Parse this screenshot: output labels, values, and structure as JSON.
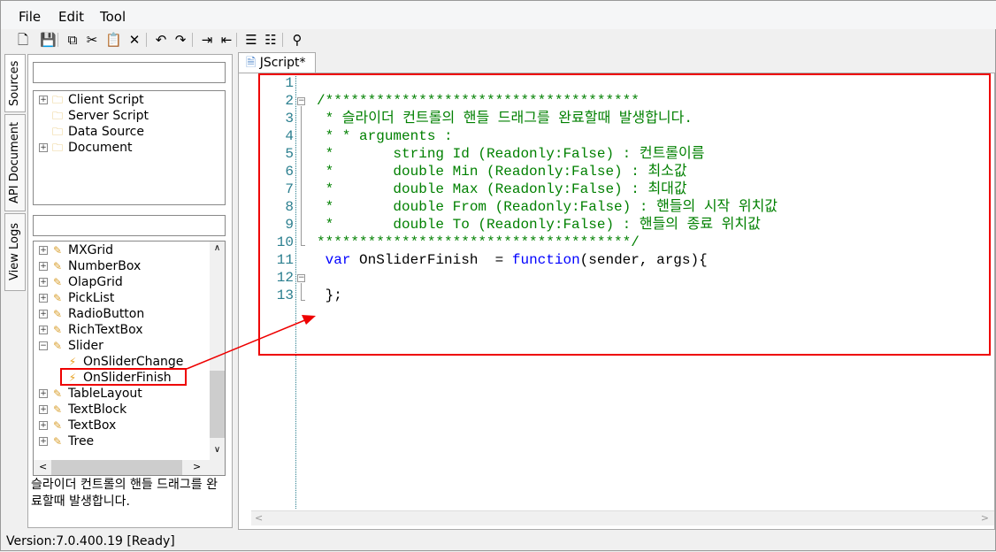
{
  "menu": [
    "File",
    "Edit",
    "Tool"
  ],
  "toolbar": [
    {
      "icon": "new-file-icon",
      "glyph": "🗋"
    },
    {
      "icon": "save-icon",
      "glyph": "💾"
    },
    {
      "icon": "copy-icon",
      "glyph": "⧉"
    },
    {
      "icon": "cut-icon",
      "glyph": "✂"
    },
    {
      "icon": "paste-icon",
      "glyph": "📋"
    },
    {
      "icon": "delete-icon",
      "glyph": "✕"
    },
    {
      "icon": "undo-icon",
      "glyph": "↶"
    },
    {
      "icon": "redo-icon",
      "glyph": "↷"
    },
    {
      "icon": "indent-icon",
      "glyph": "⇥"
    },
    {
      "icon": "outdent-icon",
      "glyph": "⇤"
    },
    {
      "icon": "comment-icon",
      "glyph": "☰"
    },
    {
      "icon": "uncomment-icon",
      "glyph": "☷"
    },
    {
      "icon": "find-icon",
      "glyph": "⚲"
    }
  ],
  "side_tabs": [
    "Sources",
    "API Document",
    "View Logs"
  ],
  "top_tree": [
    "Client Script",
    "Server Script",
    "Data Source",
    "Document"
  ],
  "control_tree": [
    "MXGrid",
    "NumberBox",
    "OlapGrid",
    "PickList",
    "RadioButton",
    "RichTextBox",
    "Slider",
    "OnSliderChange",
    "OnSliderFinish",
    "TableLayout",
    "TextBlock",
    "TextBox",
    "Tree"
  ],
  "description": "슬라이더 컨트롤의 핸들 드래그를 완료할때 발생합니다.",
  "editor_tab": "JScript*",
  "code_lines": [
    "",
    "/*************************************",
    " * 슬라이더 컨트롤의 핸들 드래그를 완료할때 발생합니다.",
    " * * arguments :",
    " *       string Id (Readonly:False) : 컨트롤이름",
    " *       double Min (Readonly:False) : 최소값",
    " *       double Max (Readonly:False) : 최대값",
    " *       double From (Readonly:False) : 핸들의 시작 위치값",
    " *       double To (Readonly:False) : 핸들의 종료 위치값",
    "*************************************/",
    " var OnSliderFinish  = function(sender, args){",
    "",
    " };"
  ],
  "status": "Version:7.0.400.19  [Ready]"
}
